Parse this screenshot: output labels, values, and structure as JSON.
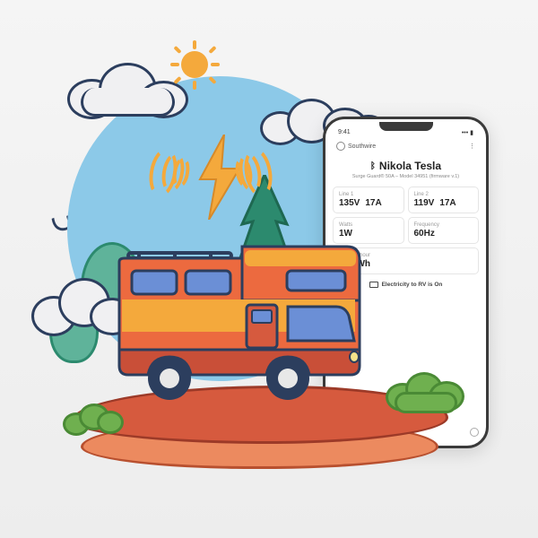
{
  "phone": {
    "status_time": "9:41",
    "brand": "Southwire",
    "device_name": "Nikola Tesla",
    "device_sub": "Surge Guard® 50A – Model 34951 (firmware v.1)",
    "readings": {
      "line1": {
        "label": "Line 1",
        "volts": "135V",
        "amps": "17A"
      },
      "line2": {
        "label": "Line 2",
        "volts": "119V",
        "amps": "17A"
      },
      "watts": {
        "label": "Watts",
        "value": "1W"
      },
      "freq": {
        "label": "Frequency",
        "value": "60Hz"
      },
      "kwh": {
        "label": "Kilowatt-hour",
        "value": "1,8kWh"
      }
    },
    "status_text": "Electricity to RV is On"
  },
  "colors": {
    "sky": "#8cc9e8",
    "sun": "#f4a93c",
    "ground": "#d65a3e",
    "rv_body": "#ec6a3f",
    "rv_top": "#f4a93c",
    "rv_window": "#6b8fd6"
  }
}
